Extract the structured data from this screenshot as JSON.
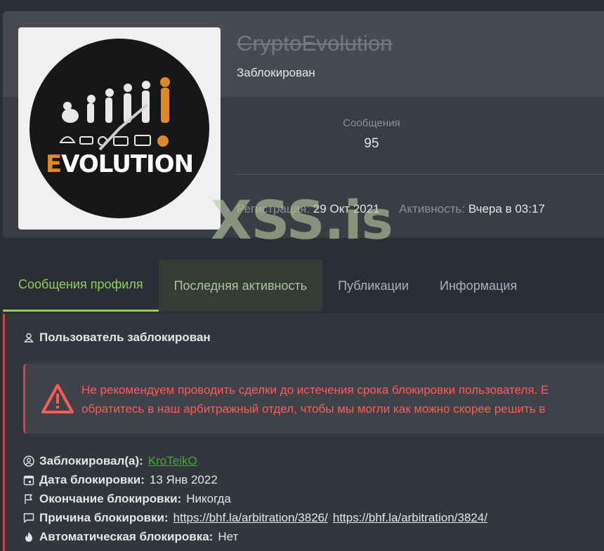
{
  "profile": {
    "username": "CryptoEvolution",
    "user_title": "Заблокирован",
    "avatar_text": "EVOLUTION",
    "stats": {
      "label": "Сообщения",
      "value": "95"
    },
    "registration_label": "Регистрация:",
    "registration_value": "29 Окт 2021",
    "activity_label": "Активность:",
    "activity_value": "Вчера в 03:17"
  },
  "watermark": "XSS.is",
  "tabs": [
    {
      "label": "Сообщения профиля",
      "state": "active"
    },
    {
      "label": "Последняя активность",
      "state": "hovered"
    },
    {
      "label": "Публикации",
      "state": "normal"
    },
    {
      "label": "Информация",
      "state": "normal"
    }
  ],
  "ban": {
    "heading": "Пользователь заблокирован",
    "alert_line1": "Не рекомендуем проводить сделки до истечения срока блокировки пользователя. Е",
    "alert_line2": "обратитесь в наш арбитражный отдел, чтобы мы могли как можно скорее решить в",
    "details": {
      "banned_by_label": "Заблокировал(а):",
      "banned_by_value": "KroTeikO",
      "ban_date_label": "Дата блокировки:",
      "ban_date_value": "13 Янв 2022",
      "ban_end_label": "Окончание блокировки:",
      "ban_end_value": "Никогда",
      "reason_label": "Причина блокировки:",
      "reason_link1": "https://bhf.la/arbitration/3826/",
      "reason_link2": "https://bhf.la/arbitration/3824/",
      "auto_label": "Автоматическая блокировка:",
      "auto_value": "Нет"
    }
  },
  "colors": {
    "accent_green": "#8bd05a",
    "danger_red": "#ff5a5a",
    "link_green": "#3fae2a"
  },
  "icons": [
    "user-icon",
    "warning-icon",
    "user-circle-icon",
    "calendar-icon",
    "flag-icon",
    "comment-icon",
    "fire-icon"
  ]
}
